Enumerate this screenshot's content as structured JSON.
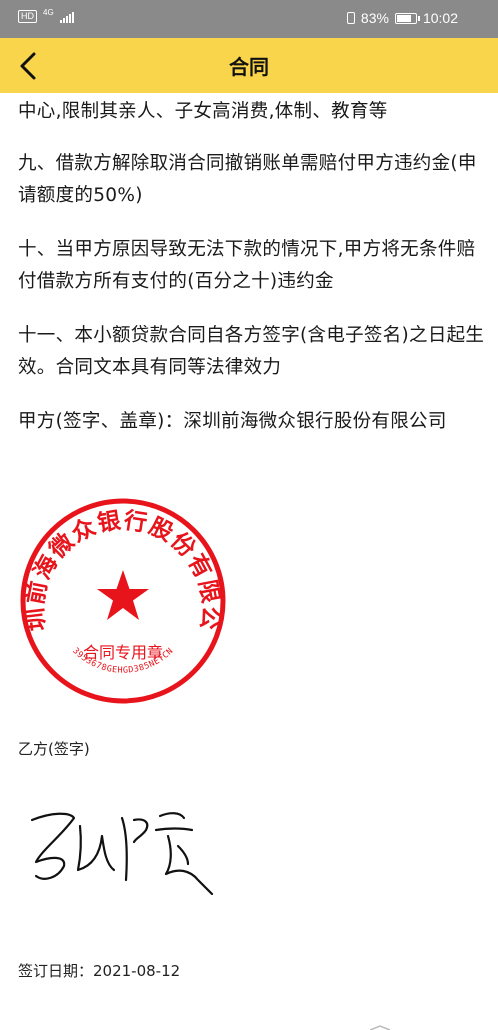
{
  "status": {
    "hd": "HD",
    "network": "4G",
    "battery_pct": "83%",
    "battery_level": 0.83,
    "time": "10:02"
  },
  "nav": {
    "title": "合同",
    "back_icon": "chevron-left-icon"
  },
  "contract": {
    "paragraphs": [
      "中心,限制其亲人、子女高消费,体制、教育等",
      "九、借款方解除取消合同撤销账单需赔付甲方违约金(申请额度的50%)",
      "十、当甲方原因导致无法下款的情况下,甲方将无条件赔付借款方所有支付的(百分之十)违约金",
      "十一、本小额贷款合同自各方签字(含电子签名)之日起生效。合同文本具有同等法律效力",
      "甲方(签字、盖章)：深圳前海微众银行股份有限公司"
    ],
    "seal": {
      "org_name": "深圳前海微众银行股份有限公司",
      "label": "合同专用章",
      "code": "3953678GEHGD385NETCN",
      "color": "#e8141c"
    },
    "party_b_label": "乙方(签字)",
    "sign_date": "签订日期：2021-08-12"
  },
  "colors": {
    "status_bar": "#8a8a8a",
    "nav_bar": "#f9d54b"
  }
}
